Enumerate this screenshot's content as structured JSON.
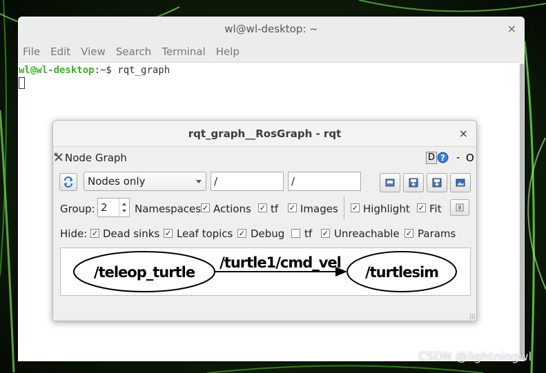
{
  "terminal": {
    "title": "wl@wl-desktop: ~",
    "close": "×",
    "menu": [
      "File",
      "Edit",
      "View",
      "Search",
      "Terminal",
      "Help"
    ],
    "prompt_user": "wl@wl-desktop",
    "prompt_path": ":~$ ",
    "command": "rqt_graph"
  },
  "rqt": {
    "title": "rqt_graph__RosGraph - rqt",
    "close": "×",
    "plugin_title": "Node Graph",
    "plugin_controls": {
      "help": "D",
      "minimize": "-",
      "close": "O"
    },
    "toolbar": {
      "mode": "Nodes only",
      "node_filter": "/",
      "topic_filter": "/"
    },
    "options": {
      "group_label": "Group:",
      "group_value": "2",
      "namespaces": "Namespaces",
      "actions": "Actions",
      "tf": "tf",
      "images": "Images",
      "highlight": "Highlight",
      "fit": "Fit"
    },
    "hide": {
      "label": "Hide:",
      "dead_sinks": "Dead sinks",
      "leaf_topics": "Leaf topics",
      "debug": "Debug",
      "tf": "tf",
      "unreachable": "Unreachable",
      "params": "Params"
    },
    "checks": {
      "actions": true,
      "tf": true,
      "images": true,
      "highlight": true,
      "fit": true,
      "dead_sinks": true,
      "leaf_topics": true,
      "debug": true,
      "hide_tf": false,
      "unreachable": true,
      "params": true
    },
    "graph": {
      "source_node": "/teleop_turtle",
      "edge_label": "/turtle1/cmd_vel",
      "target_node": "/turtlesim"
    }
  },
  "watermark": "CSDN @lightningwl",
  "colors": {
    "prompt_user": "#3fae2a",
    "background": "#0a1a0a"
  }
}
